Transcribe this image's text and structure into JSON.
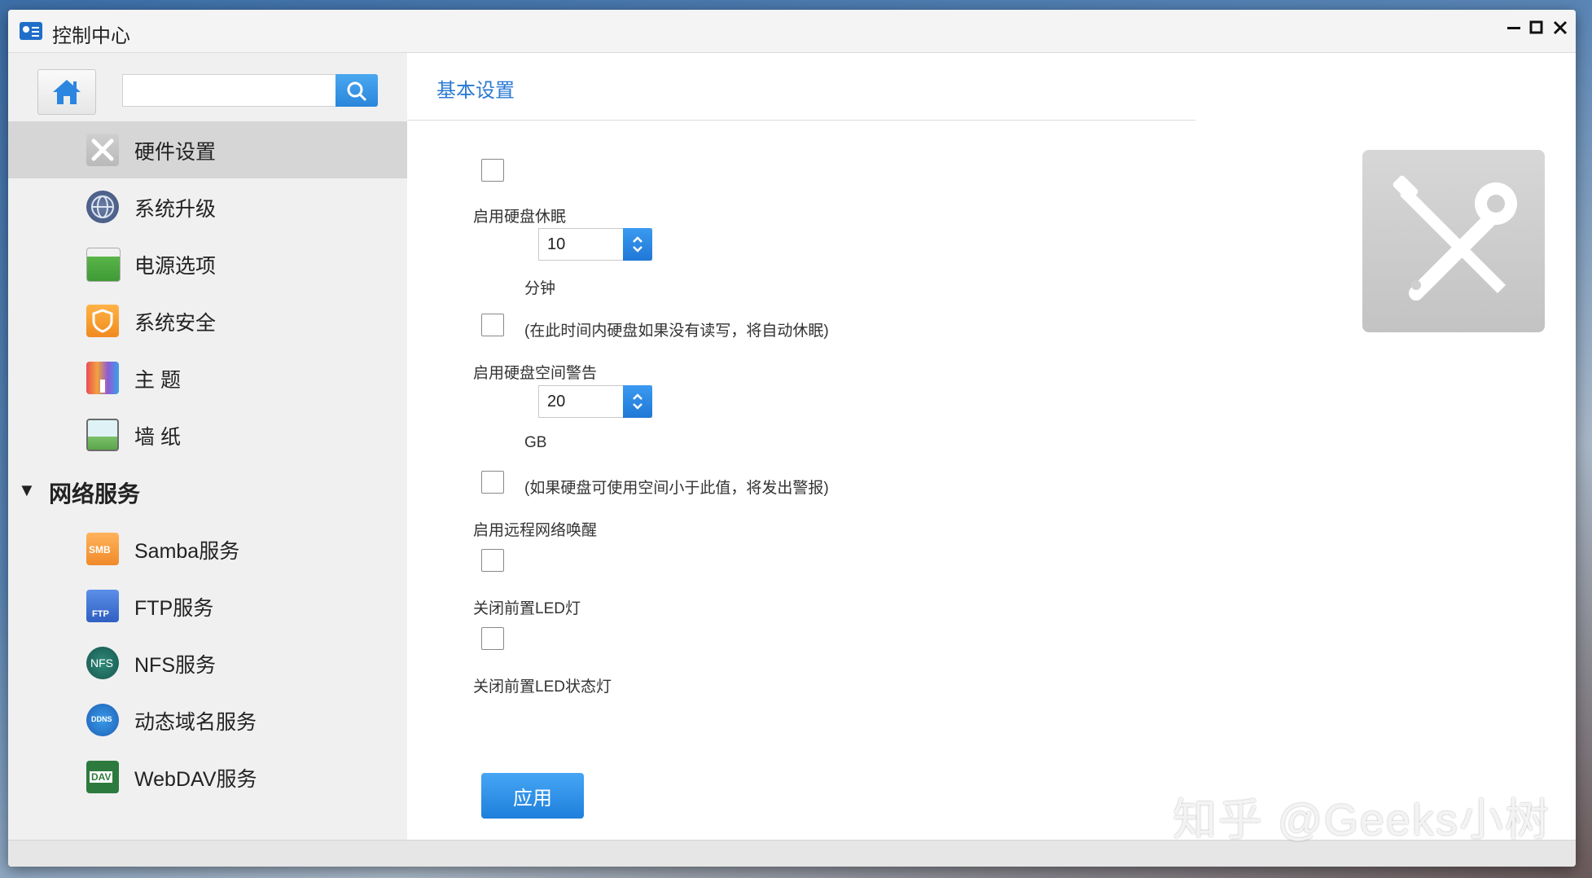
{
  "window": {
    "title": "控制中心"
  },
  "sidebar": {
    "items": [
      {
        "label": "硬件设置",
        "icon": "tools-icon",
        "active": true
      },
      {
        "label": "系统升级",
        "icon": "globe-upgrade-icon"
      },
      {
        "label": "电源选项",
        "icon": "battery-icon"
      },
      {
        "label": "系统安全",
        "icon": "shield-icon"
      },
      {
        "label": "主 题",
        "icon": "paint-roller-icon"
      },
      {
        "label": "墙 纸",
        "icon": "wallpaper-icon"
      }
    ],
    "section": {
      "label": "网络服务"
    },
    "network_items": [
      {
        "label": "Samba服务",
        "icon": "smb-folder-icon",
        "badge": "SMB"
      },
      {
        "label": "FTP服务",
        "icon": "ftp-icon",
        "badge": "FTP"
      },
      {
        "label": "NFS服务",
        "icon": "nfs-icon",
        "badge": "NFS"
      },
      {
        "label": "动态域名服务",
        "icon": "ddns-icon",
        "badge": "DDNS"
      },
      {
        "label": "WebDAV服务",
        "icon": "webdav-icon",
        "badge": "DAV"
      }
    ]
  },
  "main": {
    "title": "基本设置",
    "disk_sleep_label": "启用硬盘休眠",
    "disk_sleep_value": "10",
    "disk_sleep_unit": "分钟",
    "disk_sleep_hint": "(在此时间内硬盘如果没有读写，将自动休眠)",
    "disk_space_label": "启用硬盘空间警告",
    "disk_space_value": "20",
    "disk_space_unit": "GB",
    "disk_space_hint": "(如果硬盘可使用空间小于此值，将发出警报)",
    "wol_label": "启用远程网络唤醒",
    "led_label": "关闭前置LED灯",
    "led_status_label": "关闭前置LED状态灯",
    "apply_label": "应用"
  },
  "watermark": "知乎 @Geeks小树",
  "colors": {
    "accent": "#2a86da",
    "title_blue": "#2a7ad3",
    "active_row": "#d6d6d6"
  }
}
